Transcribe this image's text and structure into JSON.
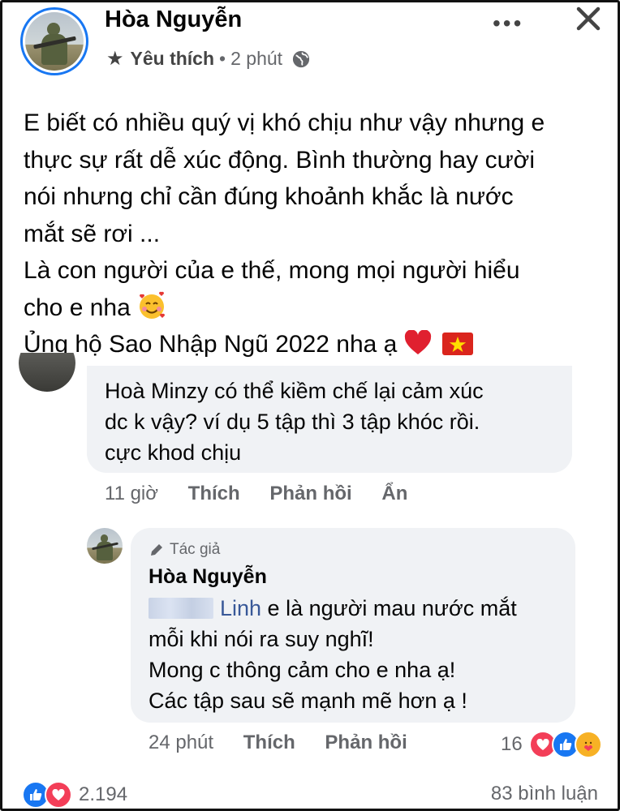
{
  "post": {
    "author": "Hòa Nguyễn",
    "badge": "Yêu thích",
    "separator": "•",
    "time": "2 phút",
    "more": "•••",
    "lines": [
      "E biết có nhiều quý vị khó chịu như vậy nhưng e",
      "thực sự rất dễ xúc động. Bình thường hay cười",
      "nói nhưng chỉ cần đúng khoảnh khắc là nước",
      "mắt sẽ rơi ...",
      "Là con người của e thế, mong mọi người hiểu",
      "cho e nha",
      "Ủng hộ Sao Nhập Ngũ 2022 nha ạ"
    ]
  },
  "comment": {
    "lines": [
      "Hoà Minzy có thể kiềm chế lại cảm xúc",
      "dc k vậy? ví dụ 5 tập thì 3 tập khóc rồi.",
      "cực khod chịu"
    ],
    "time": "11 giờ",
    "like": "Thích",
    "reply": "Phản hồi",
    "hide": "Ẩn"
  },
  "reply": {
    "badge": "Tác giả",
    "author": "Hòa Nguyễn",
    "mention": "Linh",
    "line1_rest": " e là người mau nước mắt",
    "lines": [
      "mỗi khi nói ra suy nghĩ!",
      "Mong c thông cảm cho e nha ạ!",
      "Các tập sau sẽ mạnh mẽ hơn ạ !"
    ],
    "time": "24 phút",
    "like": "Thích",
    "reply": "Phản hồi",
    "reaction_count": "16"
  },
  "footer": {
    "reaction_total": "2.194",
    "comments": "83 bình luận"
  },
  "colors": {
    "facebook_blue": "#1877f2",
    "love_red": "#f33e58",
    "care_yellow": "#f7b125",
    "secondary_text": "#65676b"
  },
  "icons": [
    "star-icon",
    "globe-icon",
    "more-icon",
    "close-icon",
    "pencil-icon",
    "like-reaction-icon",
    "love-reaction-icon",
    "care-reaction-icon"
  ]
}
